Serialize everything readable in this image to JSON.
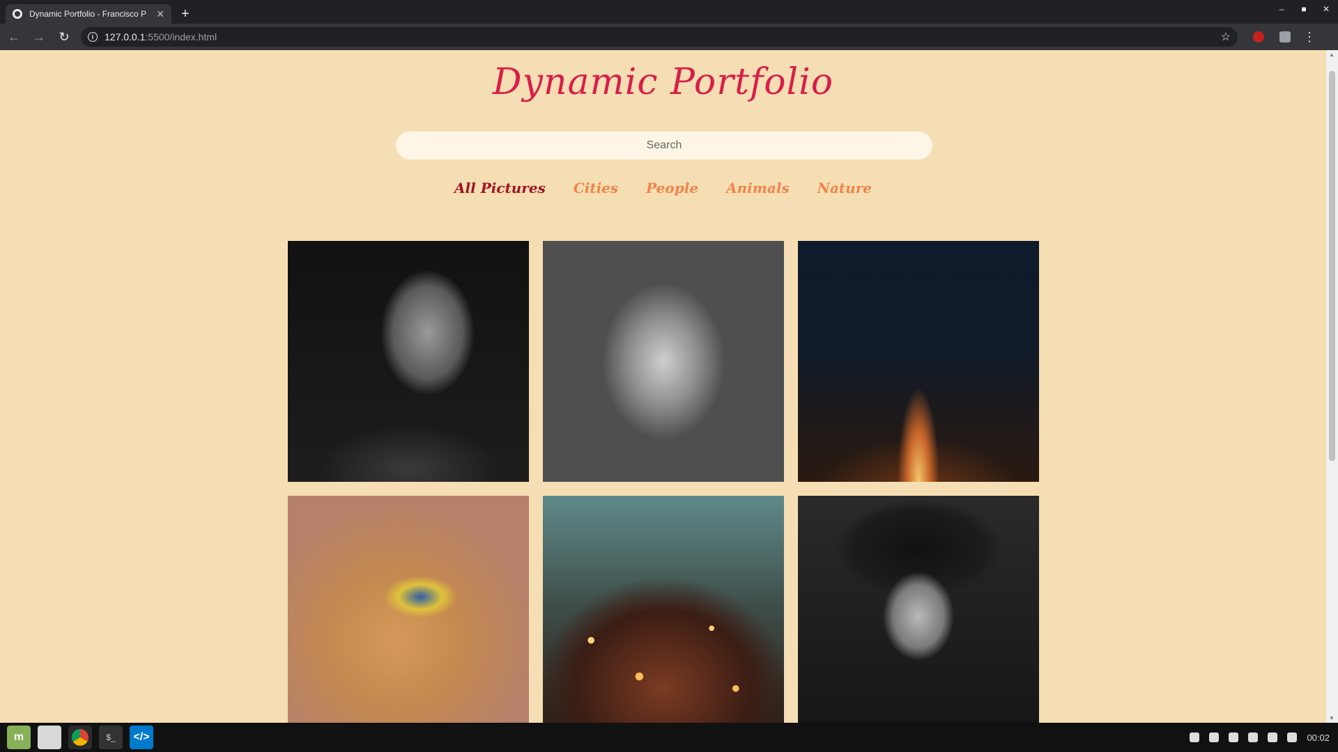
{
  "browser": {
    "tab_title": "Dynamic Portfolio - Francisco P",
    "url_host": "127.0.0.1",
    "url_path": ":5500/index.html"
  },
  "page": {
    "title": "Dynamic Portfolio",
    "search_placeholder": "Search",
    "filters": [
      "All Pictures",
      "Cities",
      "People",
      "Animals",
      "Nature"
    ],
    "active_filter": "All Pictures",
    "gallery": [
      {
        "subject": "boy portrait",
        "category": "People"
      },
      {
        "subject": "wolf",
        "category": "Animals"
      },
      {
        "subject": "city street at night",
        "category": "Cities"
      },
      {
        "subject": "blue tit bird",
        "category": "Animals"
      },
      {
        "subject": "city skyline bokeh",
        "category": "Cities"
      },
      {
        "subject": "girl with hat",
        "category": "People"
      }
    ]
  },
  "taskbar": {
    "clock": "00:02"
  },
  "colors": {
    "page_bg": "#f5deb3",
    "title": "#d81e4a",
    "filter_active": "#a01424",
    "filter": "#f0844a"
  }
}
